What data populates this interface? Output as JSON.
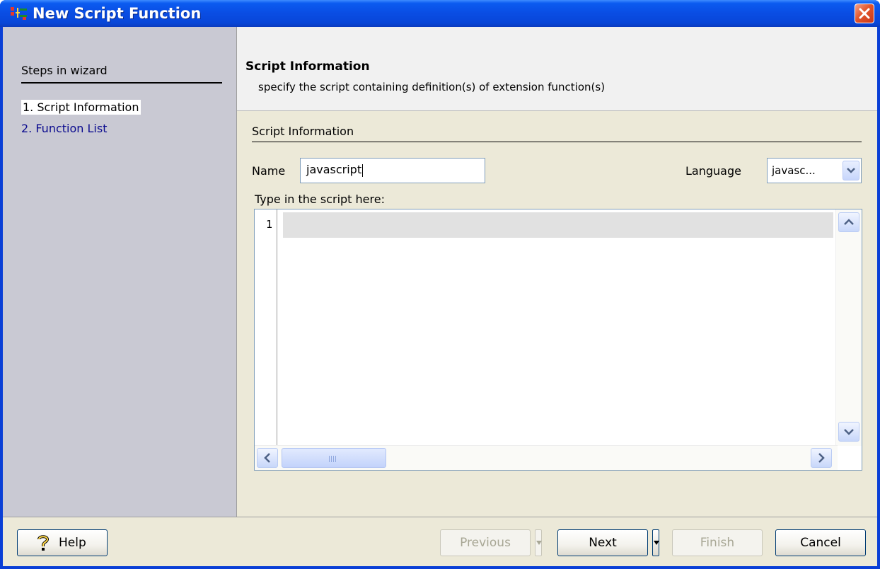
{
  "window": {
    "title": "New Script Function"
  },
  "steps": {
    "title": "Steps in wizard",
    "items": [
      {
        "label": "1. Script Information",
        "current": true
      },
      {
        "label": "2. Function List",
        "current": false
      }
    ]
  },
  "header": {
    "title": "Script Information",
    "subtitle": "specify the script containing definition(s) of extension function(s)"
  },
  "form": {
    "section_title": "Script Information",
    "name_label": "Name",
    "name_value": "javascript",
    "language_label": "Language",
    "language_value": "javasc...",
    "script_label": "Type in the script here:",
    "line_numbers": [
      "1"
    ]
  },
  "footer": {
    "help_label": "Help",
    "previous_label": "Previous",
    "next_label": "Next",
    "finish_label": "Finish",
    "cancel_label": "Cancel"
  },
  "colors": {
    "titlebar": "#0a4de3",
    "steps_panel": "#c9c9d3",
    "dialog_bg": "#ece9d8",
    "link_blue": "#0a0a8e"
  }
}
